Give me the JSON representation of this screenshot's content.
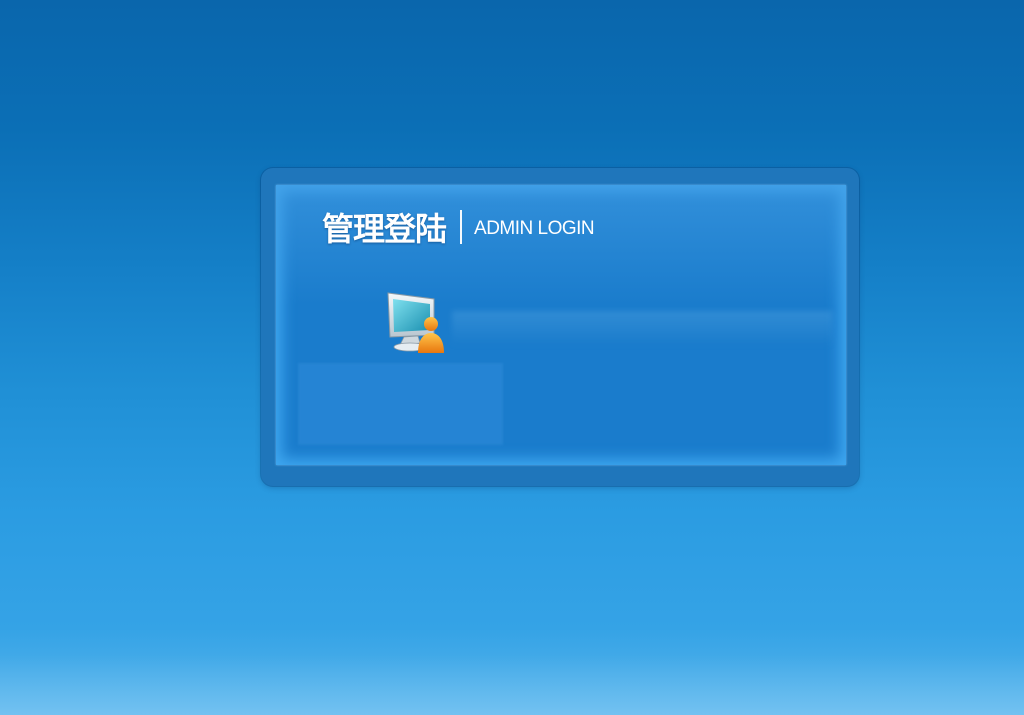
{
  "login": {
    "title_cn": "管理登陆",
    "title_en": "ADMIN LOGIN",
    "icon": "admin-computer-user-icon"
  },
  "colors": {
    "background_top": "#0a66ac",
    "background_bottom": "#5ab6ec",
    "frame": "#1f76bb",
    "panel": "#1a7ccc",
    "panel_glow": "#3fa7f0",
    "user_orange": "#f39a1f"
  }
}
